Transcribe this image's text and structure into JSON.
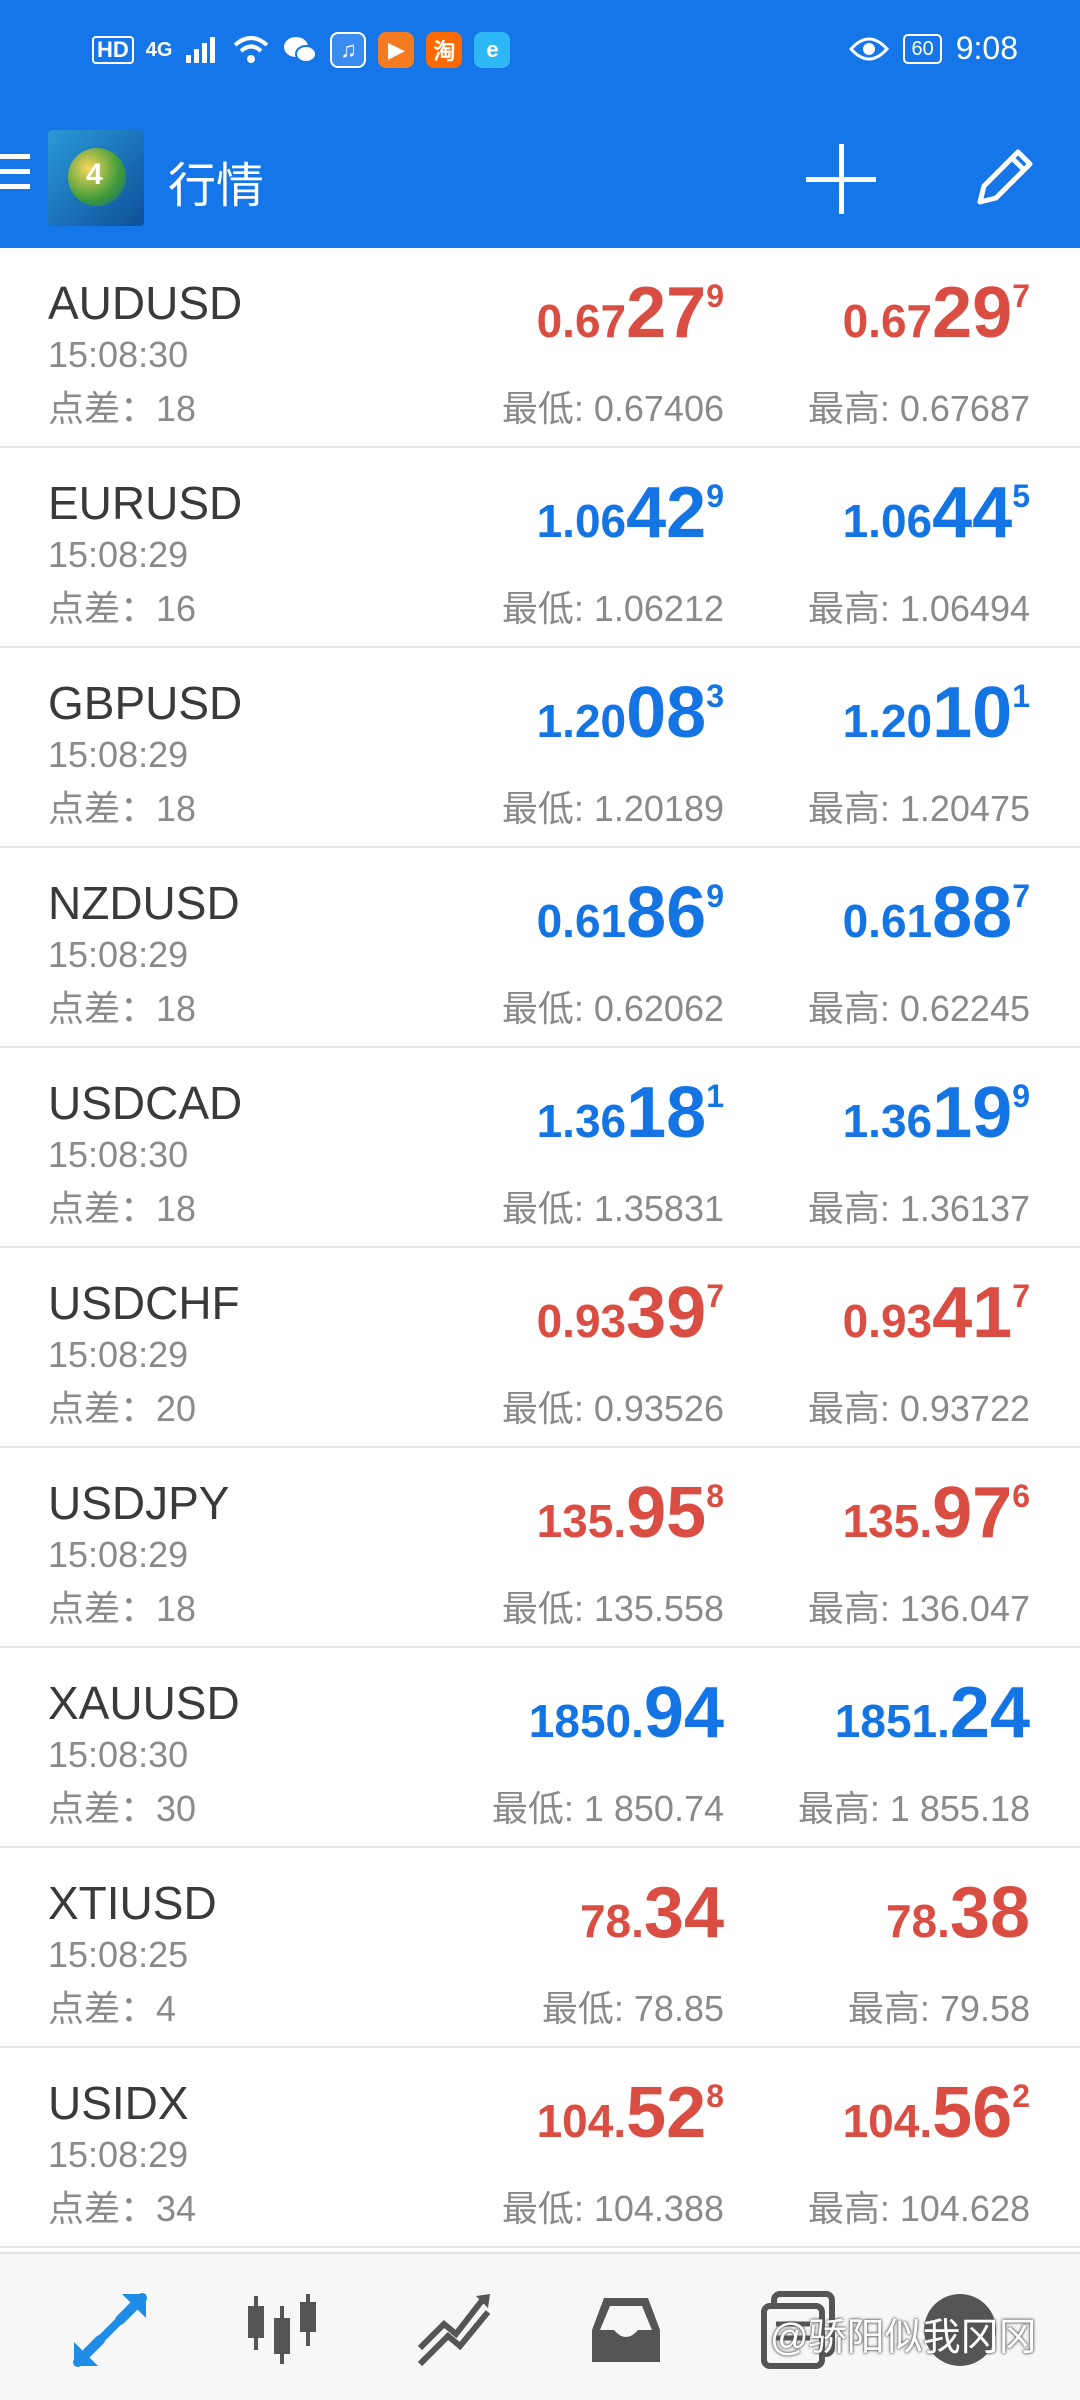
{
  "status_bar": {
    "hd": "HD",
    "network": "4G",
    "taobao_glyph": "淘",
    "time": "9:08",
    "battery": "60"
  },
  "header": {
    "title": "行情",
    "logo_number": "4"
  },
  "colors": {
    "header_bg": "#1476e8",
    "price_up": "#1474e4",
    "price_down": "#d94d43",
    "secondary_text": "#8a8a8a"
  },
  "quotes": [
    {
      "symbol": "AUDUSD",
      "time": "15:08:30",
      "spread_label": "点差：",
      "spread": "18",
      "direction": "down",
      "bid": {
        "small": "0.67",
        "big": "27",
        "sup": "9"
      },
      "ask": {
        "small": "0.67",
        "big": "29",
        "sup": "7"
      },
      "low_label": "最低:",
      "low": "0.67406",
      "high_label": "最高:",
      "high": "0.67687"
    },
    {
      "symbol": "EURUSD",
      "time": "15:08:29",
      "spread_label": "点差：",
      "spread": "16",
      "direction": "up",
      "bid": {
        "small": "1.06",
        "big": "42",
        "sup": "9"
      },
      "ask": {
        "small": "1.06",
        "big": "44",
        "sup": "5"
      },
      "low_label": "最低:",
      "low": "1.06212",
      "high_label": "最高:",
      "high": "1.06494"
    },
    {
      "symbol": "GBPUSD",
      "time": "15:08:29",
      "spread_label": "点差：",
      "spread": "18",
      "direction": "up",
      "bid": {
        "small": "1.20",
        "big": "08",
        "sup": "3"
      },
      "ask": {
        "small": "1.20",
        "big": "10",
        "sup": "1"
      },
      "low_label": "最低:",
      "low": "1.20189",
      "high_label": "最高:",
      "high": "1.20475"
    },
    {
      "symbol": "NZDUSD",
      "time": "15:08:29",
      "spread_label": "点差：",
      "spread": "18",
      "direction": "up",
      "bid": {
        "small": "0.61",
        "big": "86",
        "sup": "9"
      },
      "ask": {
        "small": "0.61",
        "big": "88",
        "sup": "7"
      },
      "low_label": "最低:",
      "low": "0.62062",
      "high_label": "最高:",
      "high": "0.62245"
    },
    {
      "symbol": "USDCAD",
      "time": "15:08:30",
      "spread_label": "点差：",
      "spread": "18",
      "direction": "up",
      "bid": {
        "small": "1.36",
        "big": "18",
        "sup": "1"
      },
      "ask": {
        "small": "1.36",
        "big": "19",
        "sup": "9"
      },
      "low_label": "最低:",
      "low": "1.35831",
      "high_label": "最高:",
      "high": "1.36137"
    },
    {
      "symbol": "USDCHF",
      "time": "15:08:29",
      "spread_label": "点差：",
      "spread": "20",
      "direction": "down",
      "bid": {
        "small": "0.93",
        "big": "39",
        "sup": "7"
      },
      "ask": {
        "small": "0.93",
        "big": "41",
        "sup": "7"
      },
      "low_label": "最低:",
      "low": "0.93526",
      "high_label": "最高:",
      "high": "0.93722"
    },
    {
      "symbol": "USDJPY",
      "time": "15:08:29",
      "spread_label": "点差：",
      "spread": "18",
      "direction": "down",
      "bid": {
        "small": "135.",
        "big": "95",
        "sup": "8"
      },
      "ask": {
        "small": "135.",
        "big": "97",
        "sup": "6"
      },
      "low_label": "最低:",
      "low": "135.558",
      "high_label": "最高:",
      "high": "136.047"
    },
    {
      "symbol": "XAUUSD",
      "time": "15:08:30",
      "spread_label": "点差：",
      "spread": "30",
      "direction": "up",
      "bid": {
        "small": "1850.",
        "big": "94",
        "sup": ""
      },
      "ask": {
        "small": "1851.",
        "big": "24",
        "sup": ""
      },
      "low_label": "最低:",
      "low": "1 850.74",
      "high_label": "最高:",
      "high": "1 855.18"
    },
    {
      "symbol": "XTIUSD",
      "time": "15:08:25",
      "spread_label": "点差：",
      "spread": "4",
      "direction": "down",
      "bid": {
        "small": "78.",
        "big": "34",
        "sup": ""
      },
      "ask": {
        "small": "78.",
        "big": "38",
        "sup": ""
      },
      "low_label": "最低:",
      "low": "78.85",
      "high_label": "最高:",
      "high": "79.58"
    },
    {
      "symbol": "USIDX",
      "time": "15:08:29",
      "spread_label": "点差：",
      "spread": "34",
      "direction": "down",
      "bid": {
        "small": "104.",
        "big": "52",
        "sup": "8"
      },
      "ask": {
        "small": "104.",
        "big": "56",
        "sup": "2"
      },
      "low_label": "最低:",
      "low": "104.388",
      "high_label": "最高:",
      "high": "104.628"
    }
  ],
  "bottom_nav": {
    "items": [
      "quotes-icon",
      "chart-icon",
      "trade-icon",
      "inbox-icon",
      "history-icon",
      "messages-icon"
    ],
    "active": "quotes-icon"
  },
  "watermark": "@骄阳似我冈冈"
}
